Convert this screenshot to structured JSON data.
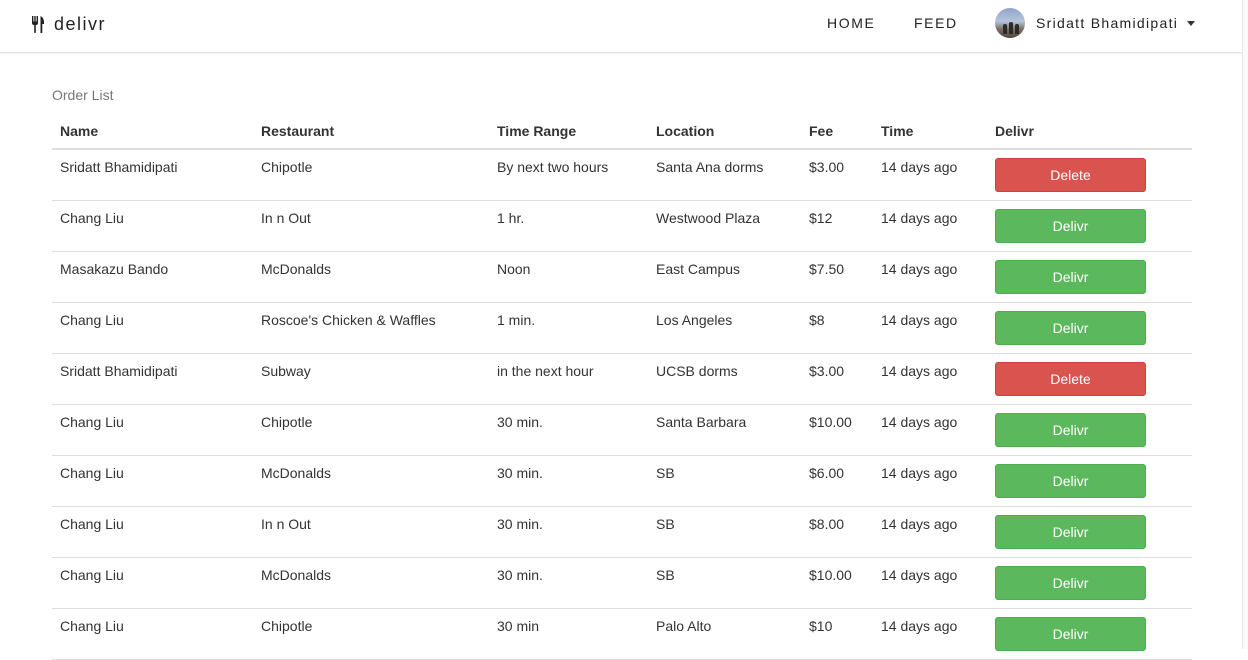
{
  "navbar": {
    "brand": "delivr",
    "links": [
      "HOME",
      "FEED"
    ],
    "user_name": "Sridatt Bhamidipati"
  },
  "page": {
    "section_title": "Order List"
  },
  "table": {
    "headers": [
      "Name",
      "Restaurant",
      "Time Range",
      "Location",
      "Fee",
      "Time",
      "Delivr"
    ],
    "rows": [
      {
        "name": "Sridatt Bhamidipati",
        "restaurant": "Chipotle",
        "time_range": "By next two hours",
        "location": "Santa Ana dorms",
        "fee": "$3.00",
        "time": "14 days ago",
        "action": "Delete"
      },
      {
        "name": "Chang Liu",
        "restaurant": "In n Out",
        "time_range": "1 hr.",
        "location": "Westwood Plaza",
        "fee": "$12",
        "time": "14 days ago",
        "action": "Delivr"
      },
      {
        "name": "Masakazu Bando",
        "restaurant": "McDonalds",
        "time_range": "Noon",
        "location": "East Campus",
        "fee": "$7.50",
        "time": "14 days ago",
        "action": "Delivr"
      },
      {
        "name": "Chang Liu",
        "restaurant": "Roscoe's Chicken & Waffles",
        "time_range": "1 min.",
        "location": "Los Angeles",
        "fee": "$8",
        "time": "14 days ago",
        "action": "Delivr"
      },
      {
        "name": "Sridatt Bhamidipati",
        "restaurant": "Subway",
        "time_range": "in the next hour",
        "location": "UCSB dorms",
        "fee": "$3.00",
        "time": "14 days ago",
        "action": "Delete"
      },
      {
        "name": "Chang Liu",
        "restaurant": "Chipotle",
        "time_range": "30 min.",
        "location": "Santa Barbara",
        "fee": "$10.00",
        "time": "14 days ago",
        "action": "Delivr"
      },
      {
        "name": "Chang Liu",
        "restaurant": "McDonalds",
        "time_range": "30 min.",
        "location": "SB",
        "fee": "$6.00",
        "time": "14 days ago",
        "action": "Delivr"
      },
      {
        "name": "Chang Liu",
        "restaurant": "In n Out",
        "time_range": "30 min.",
        "location": "SB",
        "fee": "$8.00",
        "time": "14 days ago",
        "action": "Delivr"
      },
      {
        "name": "Chang Liu",
        "restaurant": "McDonalds",
        "time_range": "30 min.",
        "location": "SB",
        "fee": "$10.00",
        "time": "14 days ago",
        "action": "Delivr"
      },
      {
        "name": "Chang Liu",
        "restaurant": "Chipotle",
        "time_range": "30 min",
        "location": "Palo Alto",
        "fee": "$10",
        "time": "14 days ago",
        "action": "Delivr"
      }
    ]
  },
  "colors": {
    "delivr_button": "#5cb85c",
    "delete_button": "#d9534f"
  },
  "icons": {
    "brand": "fork-knife-icon",
    "user_menu": "caret-down-icon"
  }
}
